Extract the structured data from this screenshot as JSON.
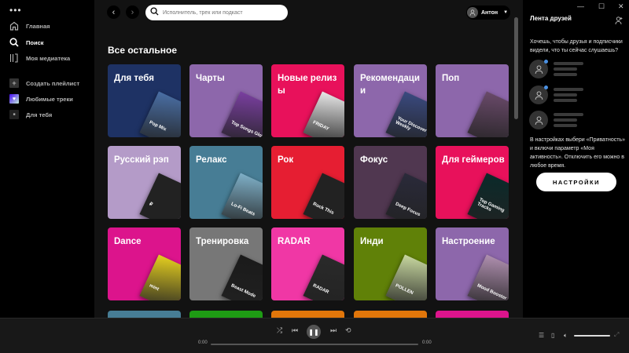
{
  "sidebar": {
    "menu_icon": "more-dots-icon",
    "nav": [
      {
        "label": "Главная",
        "icon": "home-icon"
      },
      {
        "label": "Поиск",
        "icon": "search-icon",
        "active": true
      },
      {
        "label": "Моя медиатека",
        "icon": "library-icon"
      }
    ],
    "playlists": [
      {
        "label": "Создать плейлист",
        "icon": "plus-icon"
      },
      {
        "label": "Любимые треки",
        "icon": "heart-icon"
      },
      {
        "label": "Для тебя",
        "icon": "playlist-icon"
      }
    ]
  },
  "header": {
    "search_placeholder": "Исполнитель, трек или подкаст",
    "user_name": "Антон"
  },
  "main": {
    "section_title": "Все остальное",
    "cards": [
      {
        "title": "Для тебя",
        "color": "#1e3264",
        "cover": "#4a6fa5",
        "cover_text": "Pop Mix"
      },
      {
        "title": "Чарты",
        "color": "#8d67ab",
        "cover": "#7a3fa0",
        "cover_text": "Top Songs Global"
      },
      {
        "title": "Новые релизы",
        "color": "#e8115b",
        "cover": "#e8e8e8",
        "cover_text": "FRIDAY"
      },
      {
        "title": "Рекомендации",
        "color": "#8d67ab",
        "cover": "#3a4a80",
        "cover_text": "Your Discover Weekly"
      },
      {
        "title": "Поп",
        "color": "#8d67ab",
        "cover": "#6a4a6a",
        "cover_text": ""
      },
      {
        "title": "Русский рэп",
        "color": "#b49bc8",
        "cover": "#222",
        "cover_text": "₽"
      },
      {
        "title": "Релакс",
        "color": "#477d95",
        "cover": "#7fb0c8",
        "cover_text": "Lo-Fi Beats"
      },
      {
        "title": "Рок",
        "color": "#e61e32",
        "cover": "#222",
        "cover_text": "Rock This"
      },
      {
        "title": "Фокус",
        "color": "#503750",
        "cover": "#2a2a3a",
        "cover_text": "Deep Focus"
      },
      {
        "title": "Для геймеров",
        "color": "#e8115b",
        "cover": "#0a2a2a",
        "cover_text": "Top Gaming Tracks"
      },
      {
        "title": "Dance",
        "color": "#dc148c",
        "cover": "#e6d020",
        "cover_text": "mint"
      },
      {
        "title": "Тренировка",
        "color": "#777777",
        "cover": "#1a1a1a",
        "cover_text": "Beast Mode"
      },
      {
        "title": "RADAR",
        "color": "#f037a5",
        "cover": "#2a2a2a",
        "cover_text": "RADAR"
      },
      {
        "title": "Инди",
        "color": "#608108",
        "cover": "#c8d8a0",
        "cover_text": "POLLEN"
      },
      {
        "title": "Настроение",
        "color": "#8d67ab",
        "cover": "#b090b0",
        "cover_text": "Mood Booster"
      },
      {
        "title": "",
        "color": "#477d95"
      },
      {
        "title": "",
        "color": "#1e9b14"
      },
      {
        "title": "",
        "color": "#e1760a"
      },
      {
        "title": "",
        "color": "#e1760a"
      },
      {
        "title": "",
        "color": "#dc148c"
      }
    ]
  },
  "friends": {
    "title": "Лента друзей",
    "prompt": "Хочешь, чтобы друзья и подписчики видели, что ты сейчас слушаешь?",
    "hint": "В настройках выбери «Приватность» и включи параметр «Моя активность». Отключить его можно в любое время.",
    "button": "НАСТРОЙКИ"
  },
  "player": {
    "elapsed": "0:00",
    "duration": "0:00",
    "progress": 0,
    "volume": 1.0,
    "state": "playing"
  }
}
